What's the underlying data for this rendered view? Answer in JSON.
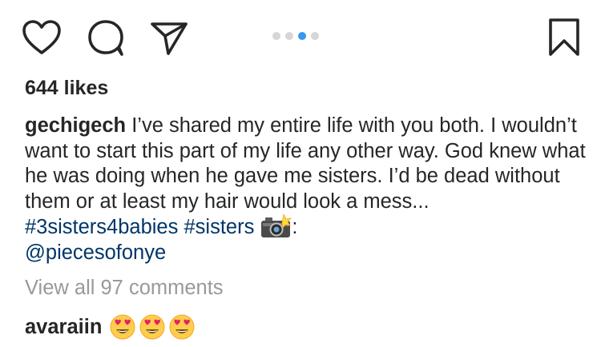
{
  "actions": {
    "like_icon": "heart-icon",
    "comment_icon": "comment-icon",
    "share_icon": "share-icon",
    "save_icon": "bookmark-icon"
  },
  "carousel": {
    "count": 4,
    "active_index": 2,
    "active_color": "#3897f0",
    "inactive_color": "#d6d6d6"
  },
  "likes": "644 likes",
  "caption": {
    "username": "gechigech",
    "text": " I’ve shared my entire life with you both. I wouldn’t want to start this part of my life any other way. God knew what he was doing when he gave me sisters. I’d be dead without them or at least my hair would look a mess... ",
    "hashtag1": "#3sisters4babies",
    "hashtag2": "#sisters",
    "emoji": "camera-with-flash",
    "colon": ":",
    "mention": "@piecesofonye"
  },
  "view_comments": "View all 97 comments",
  "comment": {
    "username": "avaraiin",
    "emojis": [
      "heart-eyes",
      "heart-eyes",
      "heart-eyes"
    ]
  },
  "colors": {
    "text": "#262626",
    "link": "#003569",
    "muted": "#999999"
  }
}
